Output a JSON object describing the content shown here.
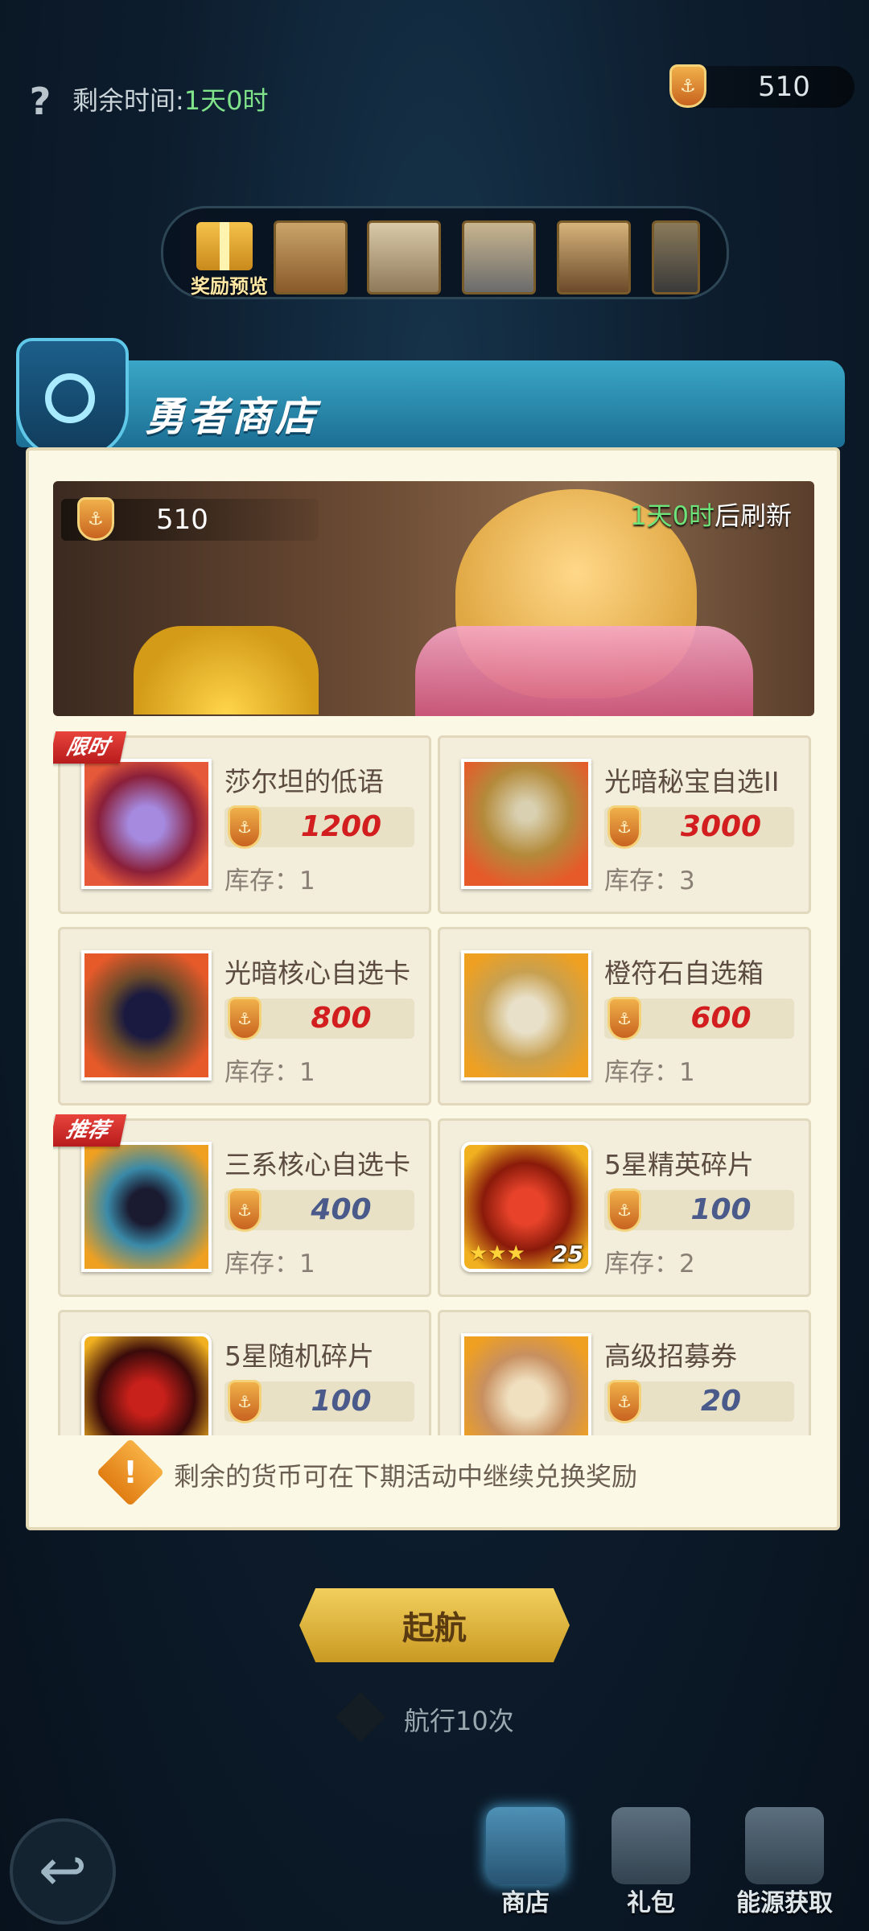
{
  "top": {
    "help_icon": "question-mark-icon",
    "time_label": "剩余时间:",
    "time_value": "1天0时",
    "currency_amount": "510"
  },
  "reward_preview": {
    "label": "奖励预览"
  },
  "shop": {
    "title": "勇者商店",
    "banner": {
      "currency_amount": "510",
      "refresh_time": "1天0时",
      "refresh_suffix": "后刷新"
    },
    "stock_prefix": "库存：",
    "items": [
      {
        "name": "莎尔坦的低语",
        "price": "1200",
        "stock": "1",
        "tag": "限时",
        "price_color": "#d21e1e"
      },
      {
        "name": "光暗秘宝自选II",
        "price": "3000",
        "stock": "3",
        "tag": "",
        "price_color": "#d21e1e"
      },
      {
        "name": "光暗核心自选卡",
        "price": "800",
        "stock": "1",
        "tag": "",
        "price_color": "#d21e1e"
      },
      {
        "name": "橙符石自选箱",
        "price": "600",
        "stock": "1",
        "tag": "",
        "price_color": "#d21e1e"
      },
      {
        "name": "三系核心自选卡",
        "price": "400",
        "stock": "1",
        "tag": "推荐",
        "price_color": "#4a5a8a"
      },
      {
        "name": "5星精英碎片",
        "price": "100",
        "stock": "2",
        "tag": "",
        "price_color": "#4a5a8a",
        "badge_count": "25"
      },
      {
        "name": "5星随机碎片",
        "price": "100",
        "stock": "",
        "tag": "",
        "price_color": "#4a5a8a"
      },
      {
        "name": "高级招募券",
        "price": "20",
        "stock": "",
        "tag": "",
        "price_color": "#4a5a8a"
      }
    ],
    "notice": "剩余的货币可在下期活动中继续兑换奖励"
  },
  "sail_button": "起航",
  "voyage_text": "航行10次",
  "nav": {
    "back_icon": "back-arrow-icon",
    "items": [
      {
        "label": "商店",
        "icon": "treasure-chest-icon"
      },
      {
        "label": "礼包",
        "icon": "gift-icon"
      },
      {
        "label": "能源获取",
        "icon": "anchor-icon"
      }
    ]
  }
}
